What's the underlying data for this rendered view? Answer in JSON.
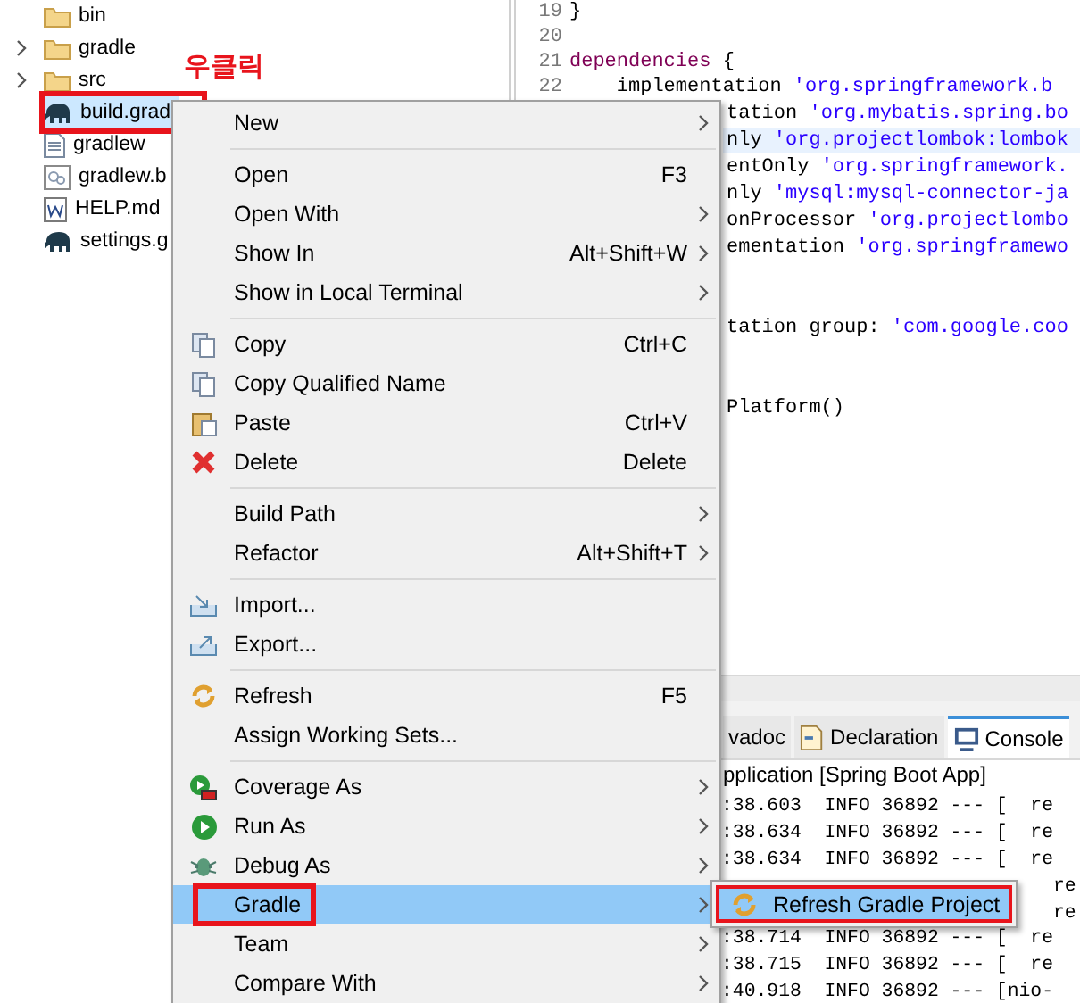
{
  "explorer": {
    "items": [
      {
        "label": "bin",
        "kind": "folder",
        "expandable": false,
        "selected": false,
        "annotated": false
      },
      {
        "label": "gradle",
        "kind": "folder",
        "expandable": true,
        "selected": false,
        "annotated": false
      },
      {
        "label": "src",
        "kind": "folder",
        "expandable": true,
        "selected": false,
        "annotated": false
      },
      {
        "label": "build.grad",
        "kind": "gradle",
        "expandable": false,
        "selected": true,
        "annotated": true
      },
      {
        "label": "gradlew",
        "kind": "file",
        "expandable": false,
        "selected": false,
        "annotated": false
      },
      {
        "label": "gradlew.b",
        "kind": "bat",
        "expandable": false,
        "selected": false,
        "annotated": false
      },
      {
        "label": "HELP.md",
        "kind": "word",
        "expandable": false,
        "selected": false,
        "annotated": false
      },
      {
        "label": "settings.g",
        "kind": "gradle",
        "expandable": false,
        "selected": false,
        "annotated": false
      }
    ]
  },
  "annotation": {
    "text": "우클릭"
  },
  "editor": {
    "lines": [
      {
        "number": "19",
        "kind": "full",
        "current": false,
        "segments": [
          {
            "text": "}",
            "kind": "plain"
          }
        ]
      },
      {
        "number": "20",
        "kind": "full",
        "current": false
      },
      {
        "number": "21",
        "kind": "full",
        "current": false,
        "segments": [
          {
            "text": "dependencies",
            "kind": "keyword"
          },
          {
            "text": " {",
            "kind": "plain"
          }
        ]
      },
      {
        "number": "22",
        "kind": "full",
        "current": false,
        "segments": [
          {
            "text": "    implementation ",
            "kind": "plain"
          },
          {
            "text": "'org.springframework.b",
            "kind": "string"
          }
        ]
      },
      {
        "kind": "clipped",
        "current": false,
        "segments": [
          {
            "text": "tation ",
            "kind": "plain"
          },
          {
            "text": "'org.mybatis.spring.bo",
            "kind": "string"
          }
        ]
      },
      {
        "kind": "clipped",
        "current": true,
        "segments": [
          {
            "text": "nly ",
            "kind": "plain"
          },
          {
            "text": "'org.projectlombok:lombok",
            "kind": "string"
          }
        ]
      },
      {
        "kind": "clipped",
        "current": false,
        "segments": [
          {
            "text": "entOnly ",
            "kind": "plain"
          },
          {
            "text": "'org.springframework.",
            "kind": "string"
          }
        ]
      },
      {
        "kind": "clipped",
        "current": false,
        "segments": [
          {
            "text": "nly ",
            "kind": "plain"
          },
          {
            "text": "'mysql:mysql-connector-ja",
            "kind": "string"
          }
        ]
      },
      {
        "kind": "clipped",
        "current": false,
        "segments": [
          {
            "text": "onProcessor ",
            "kind": "plain"
          },
          {
            "text": "'org.projectlombo",
            "kind": "string"
          }
        ]
      },
      {
        "kind": "clipped",
        "current": false,
        "segments": [
          {
            "text": "ementation ",
            "kind": "plain"
          },
          {
            "text": "'org.springframewo",
            "kind": "string"
          }
        ]
      },
      {
        "kind": "clipped",
        "current": false
      },
      {
        "kind": "clipped",
        "current": false
      },
      {
        "kind": "clipped",
        "current": false,
        "segments": [
          {
            "text": "tation group: ",
            "kind": "plain"
          },
          {
            "text": "'com.google.coo",
            "kind": "string"
          }
        ]
      },
      {
        "kind": "clipped",
        "current": false
      },
      {
        "kind": "clipped",
        "current": false
      },
      {
        "kind": "clipped",
        "current": false,
        "segments": [
          {
            "text": "Platform()",
            "kind": "plain"
          }
        ]
      }
    ]
  },
  "console": {
    "tabs": [
      {
        "label": "vadoc",
        "kind": "plain",
        "selected": false
      },
      {
        "label": "Declaration",
        "kind": "declaration",
        "selected": false
      },
      {
        "label": "Console",
        "kind": "console",
        "selected": true
      }
    ],
    "header": "pplication [Spring Boot App]",
    "rows": [
      {
        "text": ":38.603  INFO 36892 --- [  re",
        "kind": "full"
      },
      {
        "text": ":38.634  INFO 36892 --- [  re",
        "kind": "full"
      },
      {
        "text": ":38.634  INFO 36892 --- [  re",
        "kind": "full"
      },
      {
        "text": "re",
        "kind": "tail"
      },
      {
        "text": "re",
        "kind": "tail"
      },
      {
        "text": ":38.714  INFO 36892 --- [  re",
        "kind": "full"
      },
      {
        "text": ":38.715  INFO 36892 --- [  re",
        "kind": "full"
      },
      {
        "text": ":40.918  INFO 36892 --- [nio-",
        "kind": "full"
      }
    ]
  },
  "context_menu": {
    "items": [
      {
        "kind": "plain",
        "label": "New",
        "submenu": true,
        "selected": false,
        "annotated": false
      },
      {
        "kind": "separator"
      },
      {
        "kind": "plain",
        "label": "Open",
        "shortcut": "F3",
        "submenu": false,
        "selected": false,
        "annotated": false
      },
      {
        "kind": "plain",
        "label": "Open With",
        "submenu": true,
        "selected": false,
        "annotated": false
      },
      {
        "kind": "plain",
        "label": "Show In",
        "shortcut": "Alt+Shift+W",
        "submenu": true,
        "selected": false,
        "annotated": false
      },
      {
        "kind": "plain",
        "label": "Show in Local Terminal",
        "submenu": true,
        "selected": false,
        "annotated": false
      },
      {
        "kind": "separator"
      },
      {
        "kind": "copy",
        "label": "Copy",
        "shortcut": "Ctrl+C",
        "submenu": false,
        "selected": false,
        "annotated": false
      },
      {
        "kind": "copy",
        "label": "Copy Qualified Name",
        "submenu": false,
        "selected": false,
        "annotated": false
      },
      {
        "kind": "paste",
        "label": "Paste",
        "shortcut": "Ctrl+V",
        "submenu": false,
        "selected": false,
        "annotated": false
      },
      {
        "kind": "delete",
        "label": "Delete",
        "shortcut": "Delete",
        "submenu": false,
        "selected": false,
        "annotated": false
      },
      {
        "kind": "separator"
      },
      {
        "kind": "plain",
        "label": "Build Path",
        "submenu": true,
        "selected": false,
        "annotated": false
      },
      {
        "kind": "plain",
        "label": "Refactor",
        "shortcut": "Alt+Shift+T",
        "submenu": true,
        "selected": false,
        "annotated": false
      },
      {
        "kind": "separator"
      },
      {
        "kind": "import",
        "label": "Import...",
        "submenu": false,
        "selected": false,
        "annotated": false
      },
      {
        "kind": "export",
        "label": "Export...",
        "submenu": false,
        "selected": false,
        "annotated": false
      },
      {
        "kind": "separator"
      },
      {
        "kind": "refresh",
        "label": "Refresh",
        "shortcut": "F5",
        "submenu": false,
        "selected": false,
        "annotated": false
      },
      {
        "kind": "plain",
        "label": "Assign Working Sets...",
        "submenu": false,
        "selected": false,
        "annotated": false
      },
      {
        "kind": "separator"
      },
      {
        "kind": "coverage",
        "label": "Coverage As",
        "submenu": true,
        "selected": false,
        "annotated": false
      },
      {
        "kind": "run",
        "label": "Run As",
        "submenu": true,
        "selected": false,
        "annotated": false
      },
      {
        "kind": "debug",
        "label": "Debug As",
        "submenu": true,
        "selected": false,
        "annotated": false
      },
      {
        "kind": "plain",
        "label": "Gradle",
        "submenu": true,
        "selected": true,
        "annotated": true
      },
      {
        "kind": "plain",
        "label": "Team",
        "submenu": true,
        "selected": false,
        "annotated": false
      },
      {
        "kind": "plain",
        "label": "Compare With",
        "submenu": true,
        "selected": false,
        "annotated": false
      }
    ]
  },
  "submenu": {
    "items": [
      {
        "kind": "refresh",
        "label": "Refresh Gradle Project",
        "selected": true,
        "annotated": true
      }
    ]
  }
}
